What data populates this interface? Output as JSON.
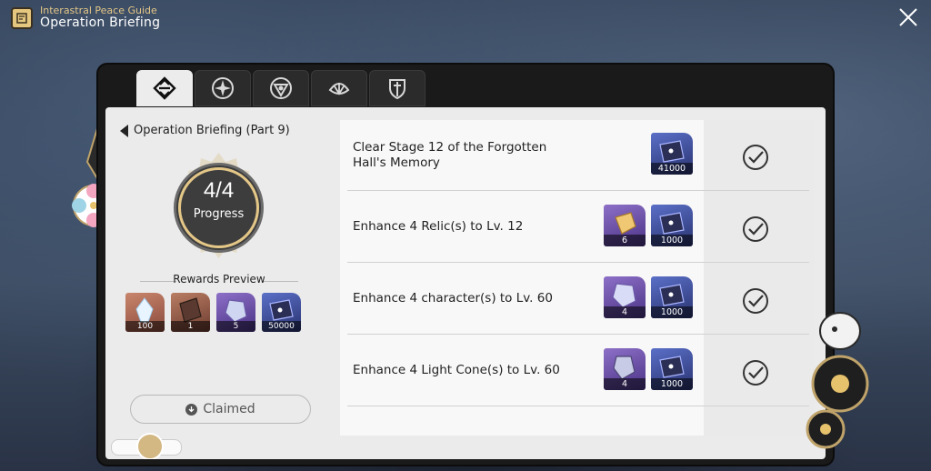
{
  "header": {
    "guide_label": "Interastral Peace Guide",
    "title": "Operation Briefing"
  },
  "tabs": [
    {
      "icon": "operation-briefing-icon",
      "active": true
    },
    {
      "icon": "compass-star-icon",
      "active": false
    },
    {
      "icon": "triangle-emblem-icon",
      "active": false
    },
    {
      "icon": "shell-emblem-icon",
      "active": false
    },
    {
      "icon": "shield-sword-icon",
      "active": false
    }
  ],
  "sidebar": {
    "back_label": "Operation Briefing (Part 9)",
    "progress_value": "4/4",
    "progress_label": "Progress",
    "progress_fraction": 1.0,
    "rewards_title": "Rewards Preview",
    "rewards": [
      {
        "icon": "crystal-material-icon",
        "count": "100"
      },
      {
        "icon": "book-material-icon",
        "count": "1"
      },
      {
        "icon": "purple-crystal-icon",
        "count": "5"
      },
      {
        "icon": "credit-icon",
        "count": "50000"
      }
    ],
    "claimed_label": "Claimed"
  },
  "missions": [
    {
      "text": "Clear Stage 12 of the Forgotten Hall's Memory",
      "rewards": [
        {
          "icon": "credit-icon",
          "count": "41000"
        }
      ],
      "completed": true
    },
    {
      "text": "Enhance 4 Relic(s) to Lv. 12",
      "rewards": [
        {
          "icon": "relic-material-icon",
          "count": "6"
        },
        {
          "icon": "credit-icon",
          "count": "1000"
        }
      ],
      "completed": true
    },
    {
      "text": "Enhance 4 character(s) to Lv. 60",
      "rewards": [
        {
          "icon": "character-exp-icon",
          "count": "4"
        },
        {
          "icon": "credit-icon",
          "count": "1000"
        }
      ],
      "completed": true
    },
    {
      "text": "Enhance 4 Light Cone(s) to Lv. 60",
      "rewards": [
        {
          "icon": "light-cone-exp-icon",
          "count": "4"
        },
        {
          "icon": "credit-icon",
          "count": "1000"
        }
      ],
      "completed": true
    }
  ],
  "colors": {
    "accent_gold": "#e4c787",
    "panel_bg": "#1a1a1a",
    "content_bg": "#ebebeb",
    "ring_dark": "#3d3d3d"
  }
}
